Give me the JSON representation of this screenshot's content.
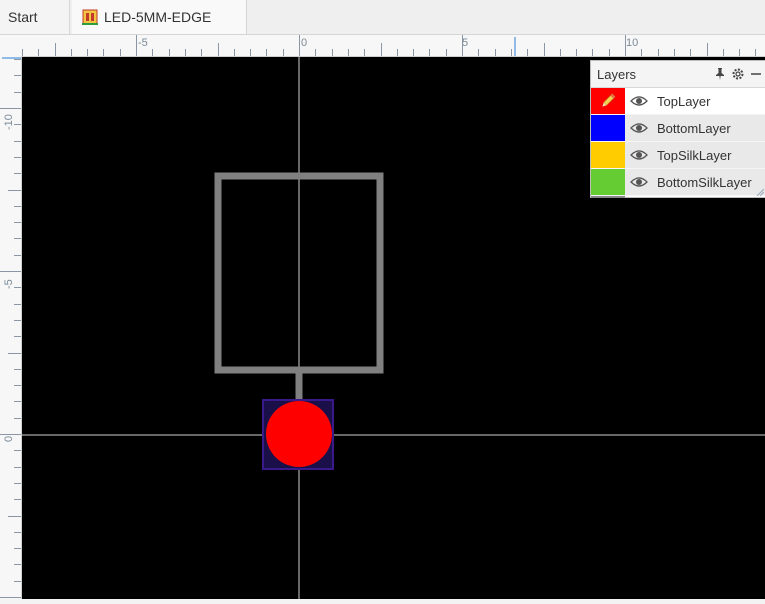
{
  "tabs": [
    {
      "label": "Start"
    },
    {
      "label": "LED-5MM-EDGE",
      "icon": "footprint-icon"
    }
  ],
  "rulers": {
    "horizontal_labels": [
      "-5",
      "0",
      "5",
      "10"
    ],
    "vertical_labels": [
      "-10",
      "-5",
      "0"
    ]
  },
  "colors": {
    "canvas_background": "#000000",
    "silkscreen_outline": "#808080",
    "top_pad": "#ff0000",
    "pad_outline": "#3a1a8a"
  },
  "layers_panel": {
    "title": "Layers",
    "icons": [
      "pin-icon",
      "gear-icon",
      "minimize-icon"
    ],
    "items": [
      {
        "label": "TopLayer",
        "color": "#ff0000",
        "active": true
      },
      {
        "label": "BottomLayer",
        "color": "#0000ff",
        "active": false
      },
      {
        "label": "TopSilkLayer",
        "color": "#ffcc00",
        "active": false
      },
      {
        "label": "BottomSilkLayer",
        "color": "#66cc33",
        "active": false
      }
    ]
  }
}
